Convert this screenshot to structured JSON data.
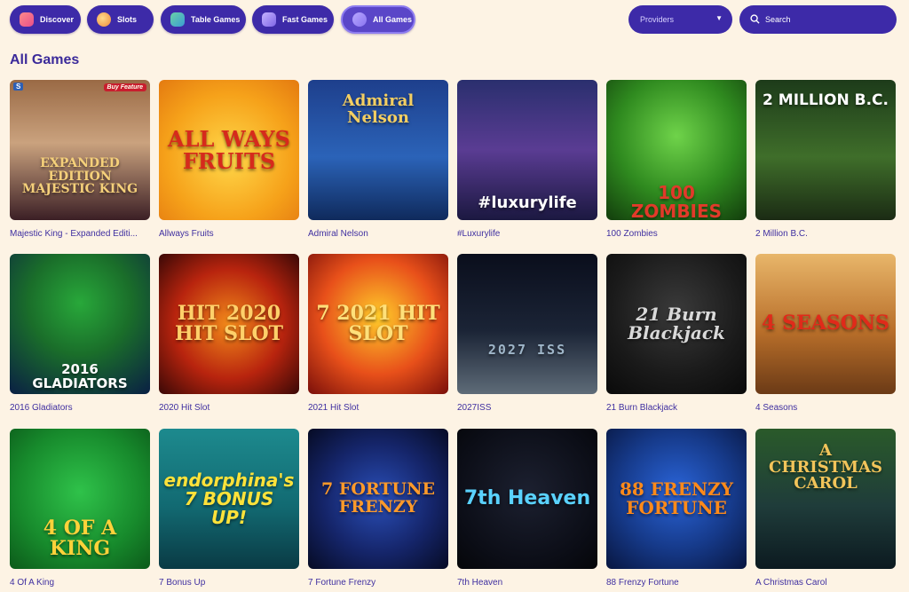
{
  "nav": {
    "tabs": [
      {
        "label": "Discover",
        "icon": "discover-icon"
      },
      {
        "label": "Slots",
        "icon": "slots-icon"
      },
      {
        "label": "Table Games",
        "icon": "table-games-icon"
      },
      {
        "label": "Fast Games",
        "icon": "fast-games-icon"
      },
      {
        "label": "All Games",
        "icon": "all-games-icon",
        "active": true
      }
    ],
    "providers_label": "Providers",
    "search_placeholder": "Search"
  },
  "section_title": "All Games",
  "colors": {
    "accent": "#3d2aa8",
    "background": "#fdf3e4",
    "text": "#3f2fa0"
  },
  "games": [
    {
      "name": "Majestic King - Expanded Editi...",
      "art": "EXPANDED EDITION MAJESTIC KING",
      "badge": "Buy Feature",
      "corner": "S"
    },
    {
      "name": "Allways Fruits",
      "art": "ALL WAYS FRUITS"
    },
    {
      "name": "Admiral Nelson",
      "art": "Admiral Nelson"
    },
    {
      "name": "#Luxurylife",
      "art": "#luxurylife"
    },
    {
      "name": "100 Zombies",
      "art": "100 ZOMBIES"
    },
    {
      "name": "2 Million B.C.",
      "art": "2 MILLION B.C."
    },
    {
      "name": "2016 Gladiators",
      "art": "2016 GLADIATORS"
    },
    {
      "name": "2020 Hit Slot",
      "art": "HIT 2020 HIT SLOT"
    },
    {
      "name": "2021 Hit Slot",
      "art": "7 2021 HIT SLOT"
    },
    {
      "name": "2027ISS",
      "art": "2027 ISS"
    },
    {
      "name": "21 Burn Blackjack",
      "art": "21 Burn Blackjack"
    },
    {
      "name": "4 Seasons",
      "art": "4 SEASONS"
    },
    {
      "name": "4 Of A King",
      "art": "4 OF A KING"
    },
    {
      "name": "7 Bonus Up",
      "art": "endorphina's 7 BONUS UP!"
    },
    {
      "name": "7 Fortune Frenzy",
      "art": "7 FORTUNE FRENZY"
    },
    {
      "name": "7th Heaven",
      "art": "7th Heaven"
    },
    {
      "name": "88 Frenzy Fortune",
      "art": "88 FRENZY FORTUNE"
    },
    {
      "name": "A Christmas Carol",
      "art": "A CHRISTMAS CAROL"
    }
  ]
}
